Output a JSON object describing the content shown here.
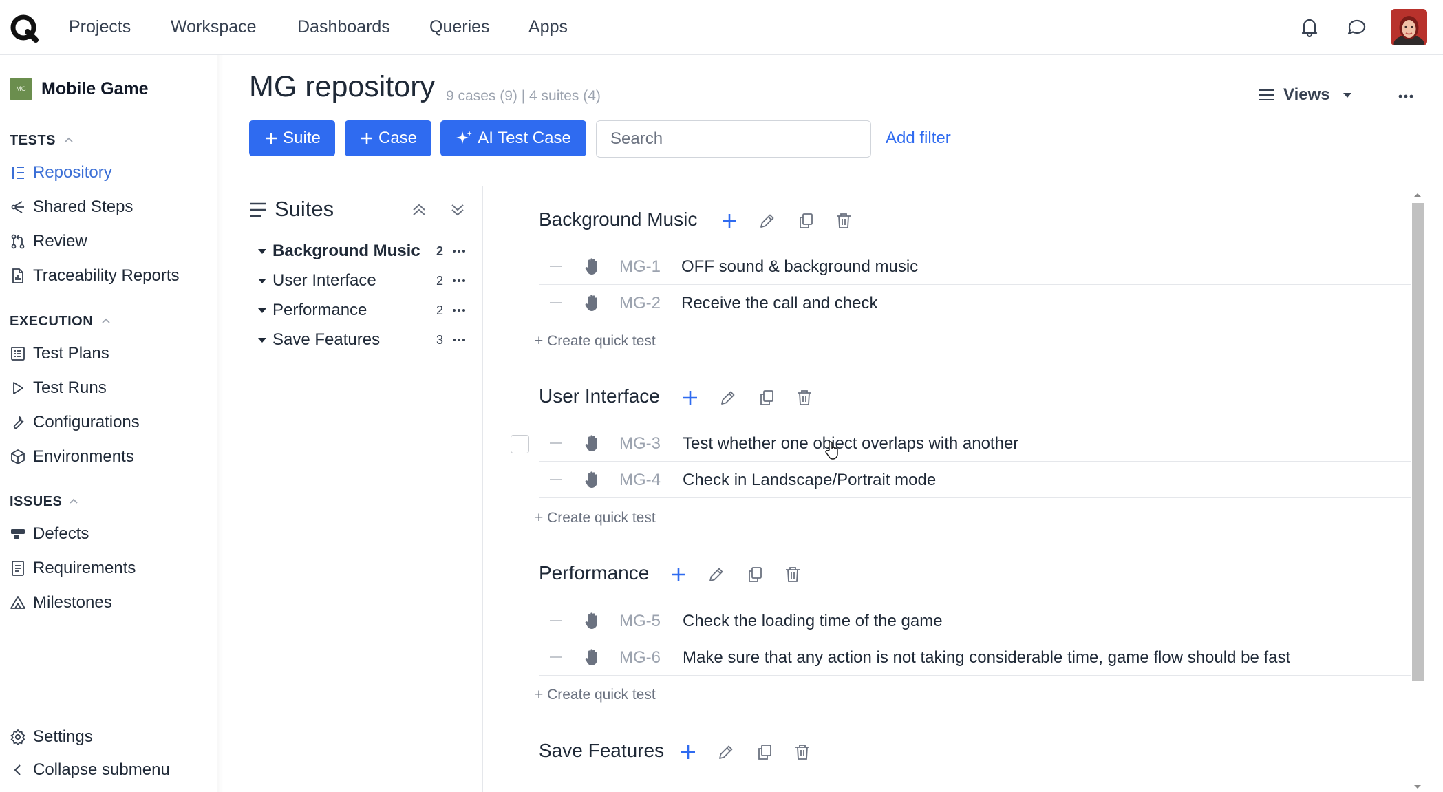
{
  "topnav": {
    "items": [
      "Projects",
      "Workspace",
      "Dashboards",
      "Queries",
      "Apps"
    ]
  },
  "sidebar": {
    "project_badge": "MG",
    "project_name": "Mobile Game",
    "tests_header": "TESTS",
    "tests_items": [
      "Repository",
      "Shared Steps",
      "Review",
      "Traceability Reports"
    ],
    "execution_header": "EXECUTION",
    "execution_items": [
      "Test Plans",
      "Test Runs",
      "Configurations",
      "Environments"
    ],
    "issues_header": "ISSUES",
    "issues_items": [
      "Defects",
      "Requirements",
      "Milestones"
    ],
    "settings": "Settings",
    "collapse": "Collapse submenu"
  },
  "header": {
    "title": "MG repository",
    "meta": "9 cases (9) | 4 suites (4)",
    "btn_suite": "Suite",
    "btn_case": "Case",
    "btn_ai": "AI Test Case",
    "search_placeholder": "Search",
    "add_filter": "Add filter",
    "views": "Views"
  },
  "tree": {
    "title": "Suites",
    "items": [
      {
        "name": "Background Music",
        "count": "2"
      },
      {
        "name": "User Interface",
        "count": "2"
      },
      {
        "name": "Performance",
        "count": "2"
      },
      {
        "name": "Save Features",
        "count": "3"
      }
    ]
  },
  "sections": [
    {
      "title": "Background Music",
      "cases": [
        {
          "id": "MG-1",
          "title": "OFF sound & background music"
        },
        {
          "id": "MG-2",
          "title": "Receive the call and check"
        }
      ]
    },
    {
      "title": "User Interface",
      "cases": [
        {
          "id": "MG-3",
          "title": "Test whether one object overlaps with another"
        },
        {
          "id": "MG-4",
          "title": "Check in Landscape/Portrait mode"
        }
      ]
    },
    {
      "title": "Performance",
      "cases": [
        {
          "id": "MG-5",
          "title": "Check the loading time of the game"
        },
        {
          "id": "MG-6",
          "title": "Make sure that any action is not taking considerable time, game flow should be fast"
        }
      ]
    },
    {
      "title": "Save Features",
      "cases": []
    }
  ],
  "quick_test_label": "+ Create quick test",
  "colors": {
    "accent": "#2f6bf0",
    "active_link": "#3b6fd6",
    "badge": "#6b8e4e"
  }
}
